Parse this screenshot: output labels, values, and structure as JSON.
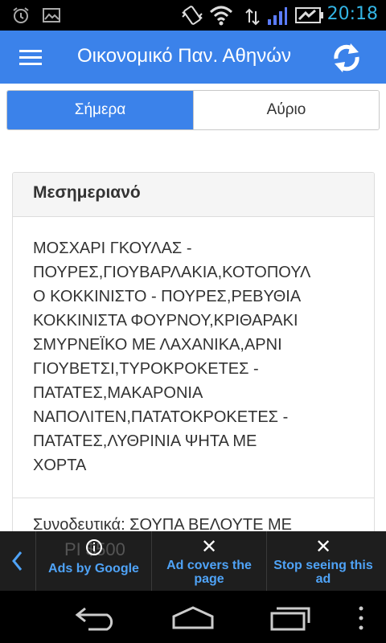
{
  "status_bar": {
    "time": "20:18",
    "icons": [
      "alarm-icon",
      "image-icon",
      "vibrate-icon",
      "wifi-icon",
      "signal-icon",
      "battery-charging-icon"
    ]
  },
  "app_bar": {
    "title": "Οικονομικό Παν. Αθηνών",
    "menu_icon": "hamburger-menu-icon",
    "refresh_icon": "refresh-icon"
  },
  "tabs": [
    {
      "label": "Σήμερα",
      "active": true
    },
    {
      "label": "Αύριο",
      "active": false
    }
  ],
  "meal": {
    "heading": "Μεσημεριανό",
    "lines": [
      "ΜΟΣΧΑΡΙ ΓΚΟΥΛΑΣ -",
      "ΠΟΥΡΕΣ,ΓΙΟΥΒΑΡΛΑΚΙΑ,ΚΟΤΟΠΟΥΛ",
      "Ο ΚΟΚΚΙΝΙΣΤΟ - ΠΟΥΡΕΣ,ΡΕΒΥΘΙΑ",
      "ΚΟΚΚΙΝΙΣΤΑ ΦΟΥΡΝΟΥ,ΚΡΙΘΑΡΑΚΙ",
      "ΣΜΥΡΝΕΪΚΟ ΜΕ ΛΑΧΑΝΙΚΑ,ΑΡΝΙ",
      "ΓΙΟΥΒΕΤΣΙ,ΤΥΡΟΚΡΟΚΕΤΕΣ -",
      "ΠΑΤΑΤΕΣ,ΜΑΚΑΡΟΝΙΑ",
      "ΝΑΠΟΛΙΤΕΝ,ΠΑΤΑΤΟΚΡΟΚΕΤΕΣ -",
      "ΠΑΤΑΤΕΣ,ΛΥΘΡΙΝΙΑ ΨΗΤΑ ΜΕ",
      "ΧΟΡΤΑ"
    ],
    "side_dishes": "Συνοδευτικά: ΣΟΥΠΑ ΒΕΛΟΥΤΕ ΜΕ"
  },
  "ad": {
    "ghost_text": "PI $500",
    "ads_by_google": "Ads by Google",
    "ad_covers_page": "Ad covers the page",
    "stop_seeing": "Stop seeing this ad",
    "accent": "#4fa3f7"
  },
  "colors": {
    "primary": "#3b82ea",
    "status_time": "#33b5e5"
  }
}
